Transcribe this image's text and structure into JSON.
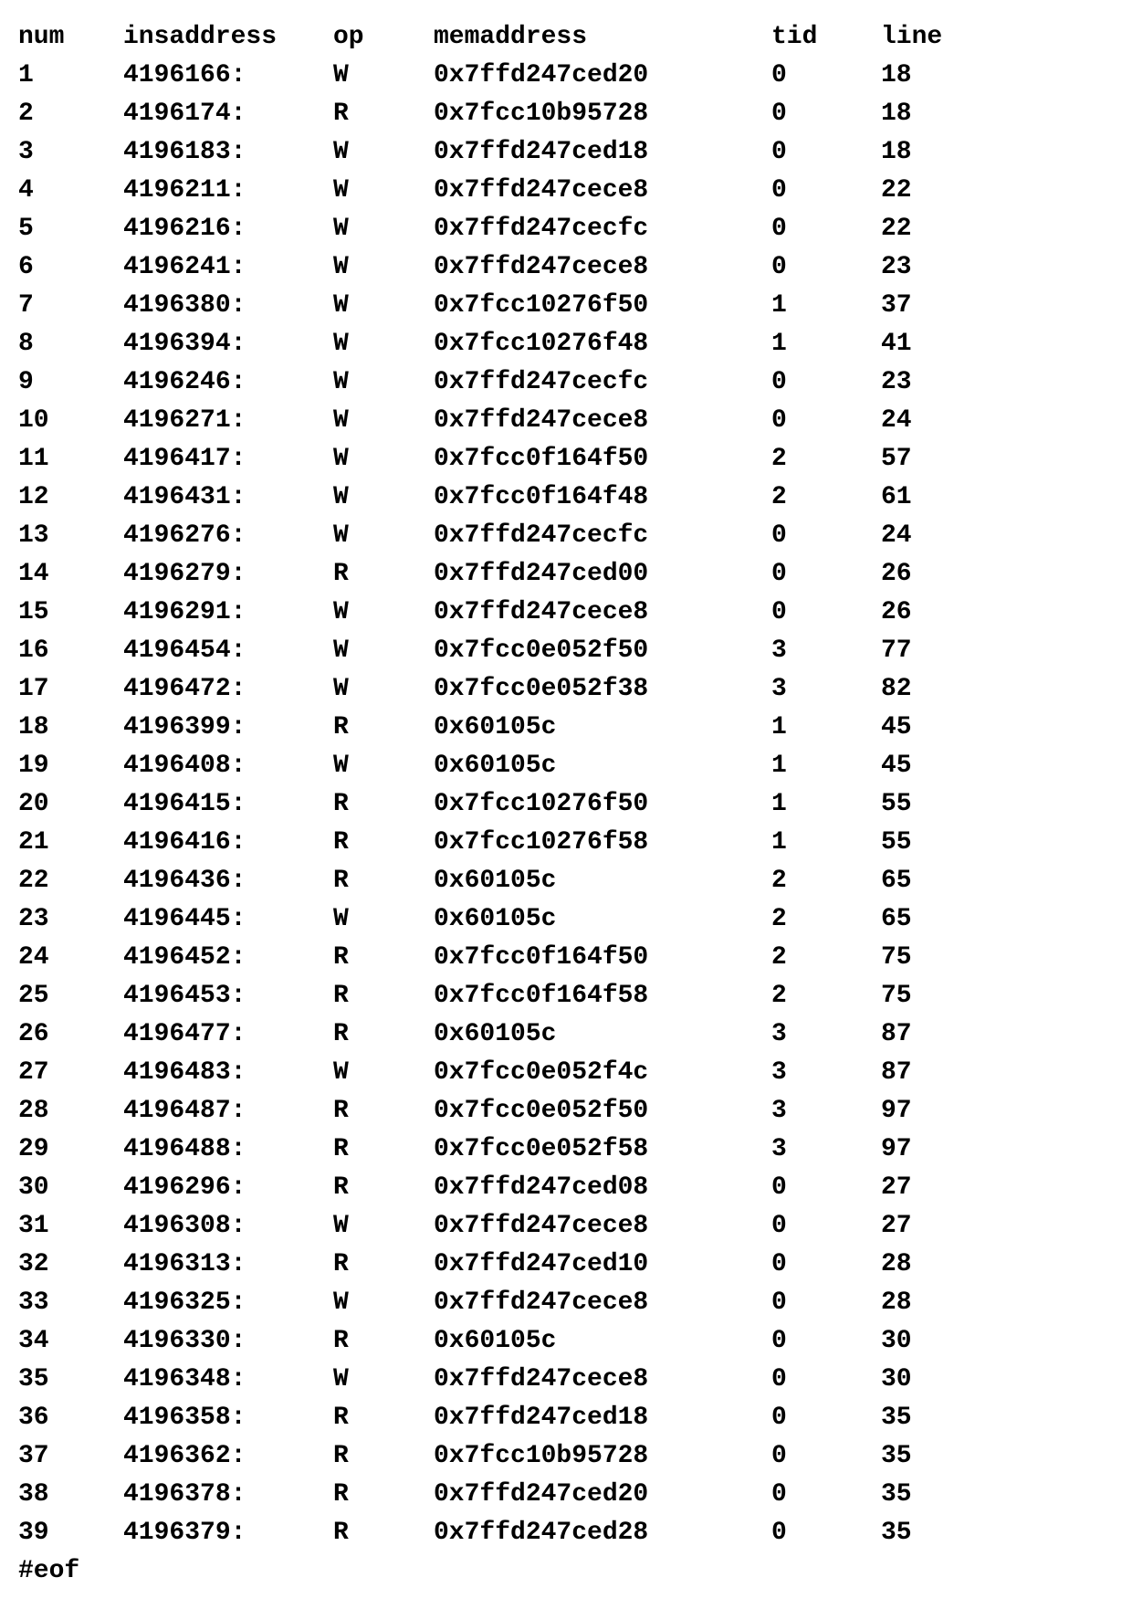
{
  "headers": {
    "num": "num",
    "insaddress": "insaddress",
    "op": "op",
    "memaddress": "memaddress",
    "tid": "tid",
    "line": "line"
  },
  "rows": [
    {
      "num": "1",
      "ins": "4196166:",
      "op": "W",
      "mem": "0x7ffd247ced20",
      "tid": "0",
      "line": "18"
    },
    {
      "num": "2",
      "ins": "4196174:",
      "op": "R",
      "mem": "0x7fcc10b95728",
      "tid": "0",
      "line": "18"
    },
    {
      "num": "3",
      "ins": "4196183:",
      "op": "W",
      "mem": "0x7ffd247ced18",
      "tid": "0",
      "line": "18"
    },
    {
      "num": "4",
      "ins": "4196211:",
      "op": "W",
      "mem": "0x7ffd247cece8",
      "tid": "0",
      "line": "22"
    },
    {
      "num": "5",
      "ins": "4196216:",
      "op": "W",
      "mem": "0x7ffd247cecfc",
      "tid": "0",
      "line": "22"
    },
    {
      "num": "6",
      "ins": "4196241:",
      "op": "W",
      "mem": "0x7ffd247cece8",
      "tid": "0",
      "line": "23"
    },
    {
      "num": "7",
      "ins": "4196380:",
      "op": "W",
      "mem": "0x7fcc10276f50",
      "tid": "1",
      "line": "37"
    },
    {
      "num": "8",
      "ins": "4196394:",
      "op": "W",
      "mem": "0x7fcc10276f48",
      "tid": "1",
      "line": "41"
    },
    {
      "num": "9",
      "ins": "4196246:",
      "op": "W",
      "mem": "0x7ffd247cecfc",
      "tid": "0",
      "line": "23"
    },
    {
      "num": "10",
      "ins": "4196271:",
      "op": "W",
      "mem": "0x7ffd247cece8",
      "tid": "0",
      "line": "24"
    },
    {
      "num": "11",
      "ins": "4196417:",
      "op": "W",
      "mem": "0x7fcc0f164f50",
      "tid": "2",
      "line": "57"
    },
    {
      "num": "12",
      "ins": "4196431:",
      "op": "W",
      "mem": "0x7fcc0f164f48",
      "tid": "2",
      "line": "61"
    },
    {
      "num": "13",
      "ins": "4196276:",
      "op": "W",
      "mem": "0x7ffd247cecfc",
      "tid": "0",
      "line": "24"
    },
    {
      "num": "14",
      "ins": "4196279:",
      "op": "R",
      "mem": "0x7ffd247ced00",
      "tid": "0",
      "line": "26"
    },
    {
      "num": "15",
      "ins": "4196291:",
      "op": "W",
      "mem": "0x7ffd247cece8",
      "tid": "0",
      "line": "26"
    },
    {
      "num": "16",
      "ins": "4196454:",
      "op": "W",
      "mem": "0x7fcc0e052f50",
      "tid": "3",
      "line": "77"
    },
    {
      "num": "17",
      "ins": "4196472:",
      "op": "W",
      "mem": "0x7fcc0e052f38",
      "tid": "3",
      "line": "82"
    },
    {
      "num": "18",
      "ins": "4196399:",
      "op": "R",
      "mem": "0x60105c",
      "tid": "1",
      "line": "45"
    },
    {
      "num": "19",
      "ins": "4196408:",
      "op": "W",
      "mem": "0x60105c",
      "tid": "1",
      "line": "45"
    },
    {
      "num": "20",
      "ins": "4196415:",
      "op": "R",
      "mem": "0x7fcc10276f50",
      "tid": "1",
      "line": "55"
    },
    {
      "num": "21",
      "ins": "4196416:",
      "op": "R",
      "mem": "0x7fcc10276f58",
      "tid": "1",
      "line": "55"
    },
    {
      "num": "22",
      "ins": "4196436:",
      "op": "R",
      "mem": "0x60105c",
      "tid": "2",
      "line": "65"
    },
    {
      "num": "23",
      "ins": "4196445:",
      "op": "W",
      "mem": "0x60105c",
      "tid": "2",
      "line": "65"
    },
    {
      "num": "24",
      "ins": "4196452:",
      "op": "R",
      "mem": "0x7fcc0f164f50",
      "tid": "2",
      "line": "75"
    },
    {
      "num": "25",
      "ins": "4196453:",
      "op": "R",
      "mem": "0x7fcc0f164f58",
      "tid": "2",
      "line": "75"
    },
    {
      "num": "26",
      "ins": "4196477:",
      "op": "R",
      "mem": "0x60105c",
      "tid": "3",
      "line": "87"
    },
    {
      "num": "27",
      "ins": "4196483:",
      "op": "W",
      "mem": "0x7fcc0e052f4c",
      "tid": "3",
      "line": "87"
    },
    {
      "num": "28",
      "ins": "4196487:",
      "op": "R",
      "mem": "0x7fcc0e052f50",
      "tid": "3",
      "line": "97"
    },
    {
      "num": "29",
      "ins": "4196488:",
      "op": "R",
      "mem": "0x7fcc0e052f58",
      "tid": "3",
      "line": "97"
    },
    {
      "num": "30",
      "ins": "4196296:",
      "op": "R",
      "mem": "0x7ffd247ced08",
      "tid": "0",
      "line": "27"
    },
    {
      "num": "31",
      "ins": "4196308:",
      "op": "W",
      "mem": "0x7ffd247cece8",
      "tid": "0",
      "line": "27"
    },
    {
      "num": "32",
      "ins": "4196313:",
      "op": "R",
      "mem": "0x7ffd247ced10",
      "tid": "0",
      "line": "28"
    },
    {
      "num": "33",
      "ins": "4196325:",
      "op": "W",
      "mem": "0x7ffd247cece8",
      "tid": "0",
      "line": "28"
    },
    {
      "num": "34",
      "ins": "4196330:",
      "op": "R",
      "mem": "0x60105c",
      "tid": "0",
      "line": "30"
    },
    {
      "num": "35",
      "ins": "4196348:",
      "op": "W",
      "mem": "0x7ffd247cece8",
      "tid": "0",
      "line": "30"
    },
    {
      "num": "36",
      "ins": "4196358:",
      "op": "R",
      "mem": "0x7ffd247ced18",
      "tid": "0",
      "line": "35"
    },
    {
      "num": "37",
      "ins": "4196362:",
      "op": "R",
      "mem": "0x7fcc10b95728",
      "tid": "0",
      "line": "35"
    },
    {
      "num": "38",
      "ins": "4196378:",
      "op": "R",
      "mem": "0x7ffd247ced20",
      "tid": "0",
      "line": "35"
    },
    {
      "num": "39",
      "ins": "4196379:",
      "op": "R",
      "mem": "0x7ffd247ced28",
      "tid": "0",
      "line": "35"
    }
  ],
  "eof": "#eof"
}
